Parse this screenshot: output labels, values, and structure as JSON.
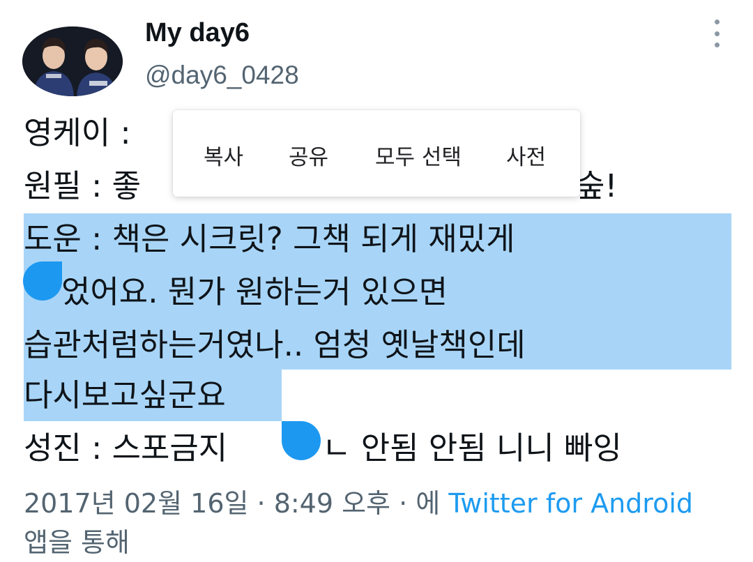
{
  "header": {
    "display_name": "My day6",
    "handle": "@day6_0428"
  },
  "tweet": {
    "lines": [
      "영케이 : ",
      "원필 : 좋",
      "",
      "도운 : 책은 시크릿? 그책 되게 재밌게",
      "었어요. 뭔가 원하는거 있으면",
      "습관처럼하는거였나.. 엄청 옛날책인데",
      "다시보고싶군요",
      "성진 : 스포금지",
      "ㄴ 안됨 안됨 니니 빠잉"
    ],
    "partial_tail": "숲!"
  },
  "context_menu": {
    "items": [
      "복사",
      "공유",
      "모두 선택",
      "사전"
    ]
  },
  "meta": {
    "timestamp": "2017년 02월 16일 · 8:49 오후 · 에 ",
    "via": "Twitter for Android",
    "suffix": "앱을 통해"
  },
  "colors": {
    "selection": "#a8d5f7",
    "handle": "#1d98f0",
    "link": "#1d9bf0",
    "secondary_text": "#536471"
  }
}
